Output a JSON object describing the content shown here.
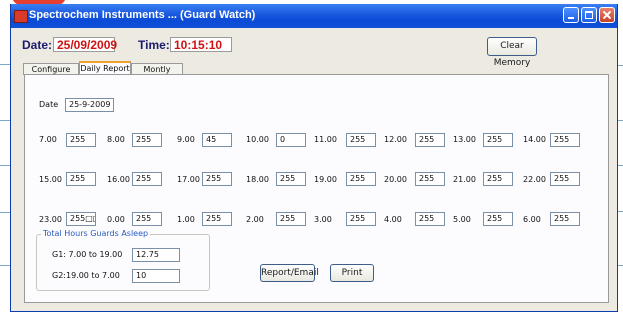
{
  "window": {
    "title": "Spectrochem Instruments ... (Guard Watch)"
  },
  "header": {
    "date_label": "Date:",
    "date_value": "25/09/2009",
    "time_label": "Time:",
    "time_value": "10:15:10",
    "clear_memory_label": "Clear Memory"
  },
  "tabs": [
    "Configure System",
    "Daily Report",
    "Montly Report"
  ],
  "panel": {
    "date_label": "Date",
    "date_value": "25-9-2009",
    "rows": [
      [
        {
          "label": "7.00",
          "value": "255"
        },
        {
          "label": "8.00",
          "value": "255"
        },
        {
          "label": "9.00",
          "value": "45"
        },
        {
          "label": "10.00",
          "value": "0"
        },
        {
          "label": "11.00",
          "value": "255"
        },
        {
          "label": "12.00",
          "value": "255"
        },
        {
          "label": "13.00",
          "value": "255"
        },
        {
          "label": "14.00",
          "value": "255"
        }
      ],
      [
        {
          "label": "15.00",
          "value": "255"
        },
        {
          "label": "16.00",
          "value": "255"
        },
        {
          "label": "17.00",
          "value": "255"
        },
        {
          "label": "18.00",
          "value": "255"
        },
        {
          "label": "19.00",
          "value": "255"
        },
        {
          "label": "20.00",
          "value": "255"
        },
        {
          "label": "21.00",
          "value": "255"
        },
        {
          "label": "22.00",
          "value": "255"
        }
      ],
      [
        {
          "label": "23.00",
          "value": "255□□"
        },
        {
          "label": "0.00",
          "value": "255"
        },
        {
          "label": "1.00",
          "value": "255"
        },
        {
          "label": "2.00",
          "value": "255"
        },
        {
          "label": "3.00",
          "value": "255"
        },
        {
          "label": "4.00",
          "value": "255"
        },
        {
          "label": "5.00",
          "value": "255"
        },
        {
          "label": "6.00",
          "value": "255"
        }
      ]
    ],
    "group": {
      "title": "Total Hours Guards Asleep",
      "g1_label": "G1: 7.00 to 19.00",
      "g1_value": "12.75",
      "g2_label": "G2:19.00 to 7.00",
      "g2_value": "10"
    },
    "report_email_label": "Report/Email",
    "print_label": "Print"
  },
  "colors": {
    "titlebar": "#0b4ad5",
    "window_bg": "#eceae1",
    "header_value": "#d11212",
    "group_title": "#2a5abf"
  }
}
